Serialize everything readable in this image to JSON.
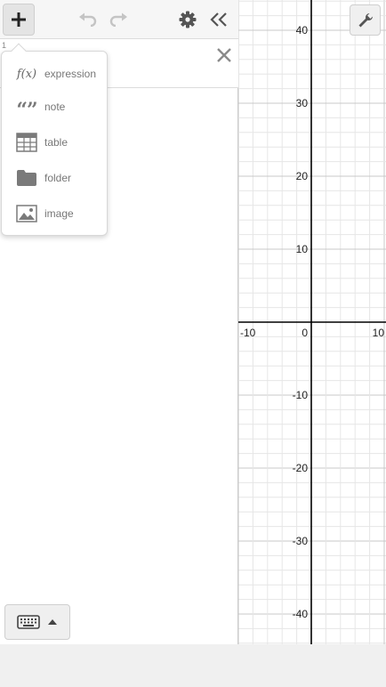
{
  "toolbar": {
    "add_icon": "plus-icon",
    "undo_icon": "undo-icon",
    "redo_icon": "redo-icon",
    "settings_icon": "gear-icon",
    "collapse_icon": "double-chevron-left-icon"
  },
  "expression_list": {
    "first_index": "1"
  },
  "add_menu": {
    "items": [
      {
        "label": "expression",
        "icon": "function-icon",
        "icon_text": "f(x)"
      },
      {
        "label": "note",
        "icon": "quote-icon",
        "icon_text": "“”"
      },
      {
        "label": "table",
        "icon": "table-icon"
      },
      {
        "label": "folder",
        "icon": "folder-icon"
      },
      {
        "label": "image",
        "icon": "image-icon"
      }
    ]
  },
  "keypad": {
    "icon": "keyboard-icon",
    "toggle_icon": "caret-up-icon"
  },
  "graph": {
    "x_ticks": [
      "-10",
      "0",
      "10"
    ],
    "y_ticks": [
      "40",
      "30",
      "20",
      "10",
      "-10",
      "-20",
      "-30",
      "-40"
    ],
    "grid": true,
    "axis_color": "#000000",
    "grid_minor_color": "#e6e6e6",
    "grid_major_color": "#c8c8c8",
    "settings_icon": "wrench-icon"
  },
  "colors": {
    "panel_bg": "#ffffff",
    "toolbar_bg": "#f6f6f6",
    "icon_gray": "#777777"
  }
}
